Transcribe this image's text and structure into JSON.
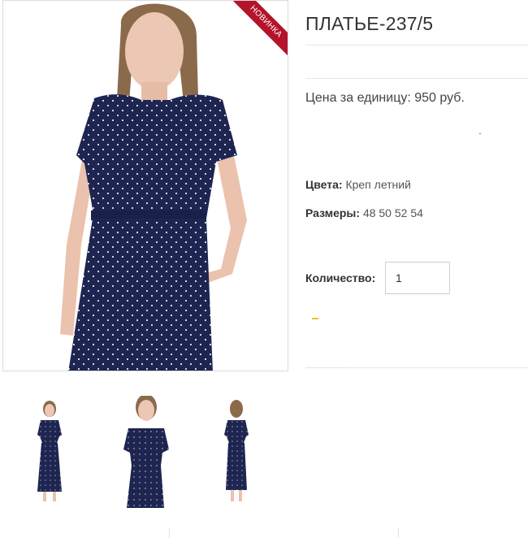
{
  "product": {
    "title": "ПЛАТЬЕ-237/5",
    "badge": "НОВИНКА",
    "price_line": "Цена за единицу: 950 руб.",
    "colors_label": "Цвета:",
    "colors_value": "Креп летний",
    "sizes_label": "Размеры:",
    "sizes_value": "48 50 52 54",
    "quantity_label": "Количество:",
    "quantity_value": "1"
  },
  "images": {
    "main": "model-dress-front-photo",
    "thumbnails": [
      "dress-full-front-thumb",
      "dress-upper-front-thumb",
      "dress-full-back-thumb"
    ]
  },
  "colors": {
    "ribbon": "#b3142a",
    "dress": "#1d2550",
    "skin": "#e9c1ad",
    "hair": "#8a6a4b"
  }
}
